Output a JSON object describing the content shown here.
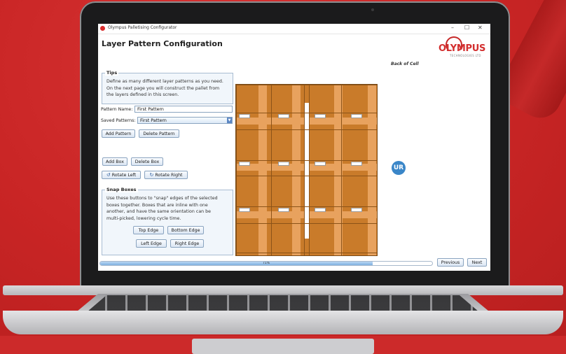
{
  "window": {
    "title": "Olympus Palletising Configurator",
    "minimize": "–",
    "maximize": "☐",
    "close": "✕"
  },
  "page": {
    "title": "Layer Pattern Configuration",
    "back_of_cell": "Back of Cell"
  },
  "logo": {
    "word": "OLYMPUS",
    "sub": "TECHNOLOGIES LTD",
    "ur": "UR"
  },
  "tips": {
    "legend": "Tips",
    "lines": [
      "Define as many different layer patterns as you need.",
      "On the next page you will construct the pallet from",
      "the layers defined in this screen."
    ]
  },
  "pattern": {
    "name_label": "Pattern Name:",
    "name_value": "First Pattern",
    "saved_label": "Saved Patterns:",
    "saved_value": "First Pattern",
    "add_label": "Add Pattern",
    "delete_label": "Delete Pattern"
  },
  "box": {
    "add_label": "Add Box",
    "delete_label": "Delete Box",
    "rotate_left_label": "Rotate Left",
    "rotate_right_label": "Rotate Right"
  },
  "snap": {
    "legend": "Snap Boxes",
    "lines": [
      "Use these buttons to \"snap\" edges of the selected",
      "boxes together. Boxes that are inline with one",
      "another, and have the same orientation can be",
      "multi-picked, lowering cycle time."
    ],
    "top_label": "Top Edge",
    "bottom_label": "Bottom Edge",
    "left_label": "Left Edge",
    "right_label": "Right Edge"
  },
  "progress": {
    "value": 0.82,
    "text": "71%"
  },
  "nav": {
    "previous_label": "Previous",
    "next_label": "Next"
  },
  "colors": {
    "accent": "#d32f2f",
    "box": "#c97b2a",
    "box_light": "#e8a25e",
    "background": "#cc2a2a"
  }
}
